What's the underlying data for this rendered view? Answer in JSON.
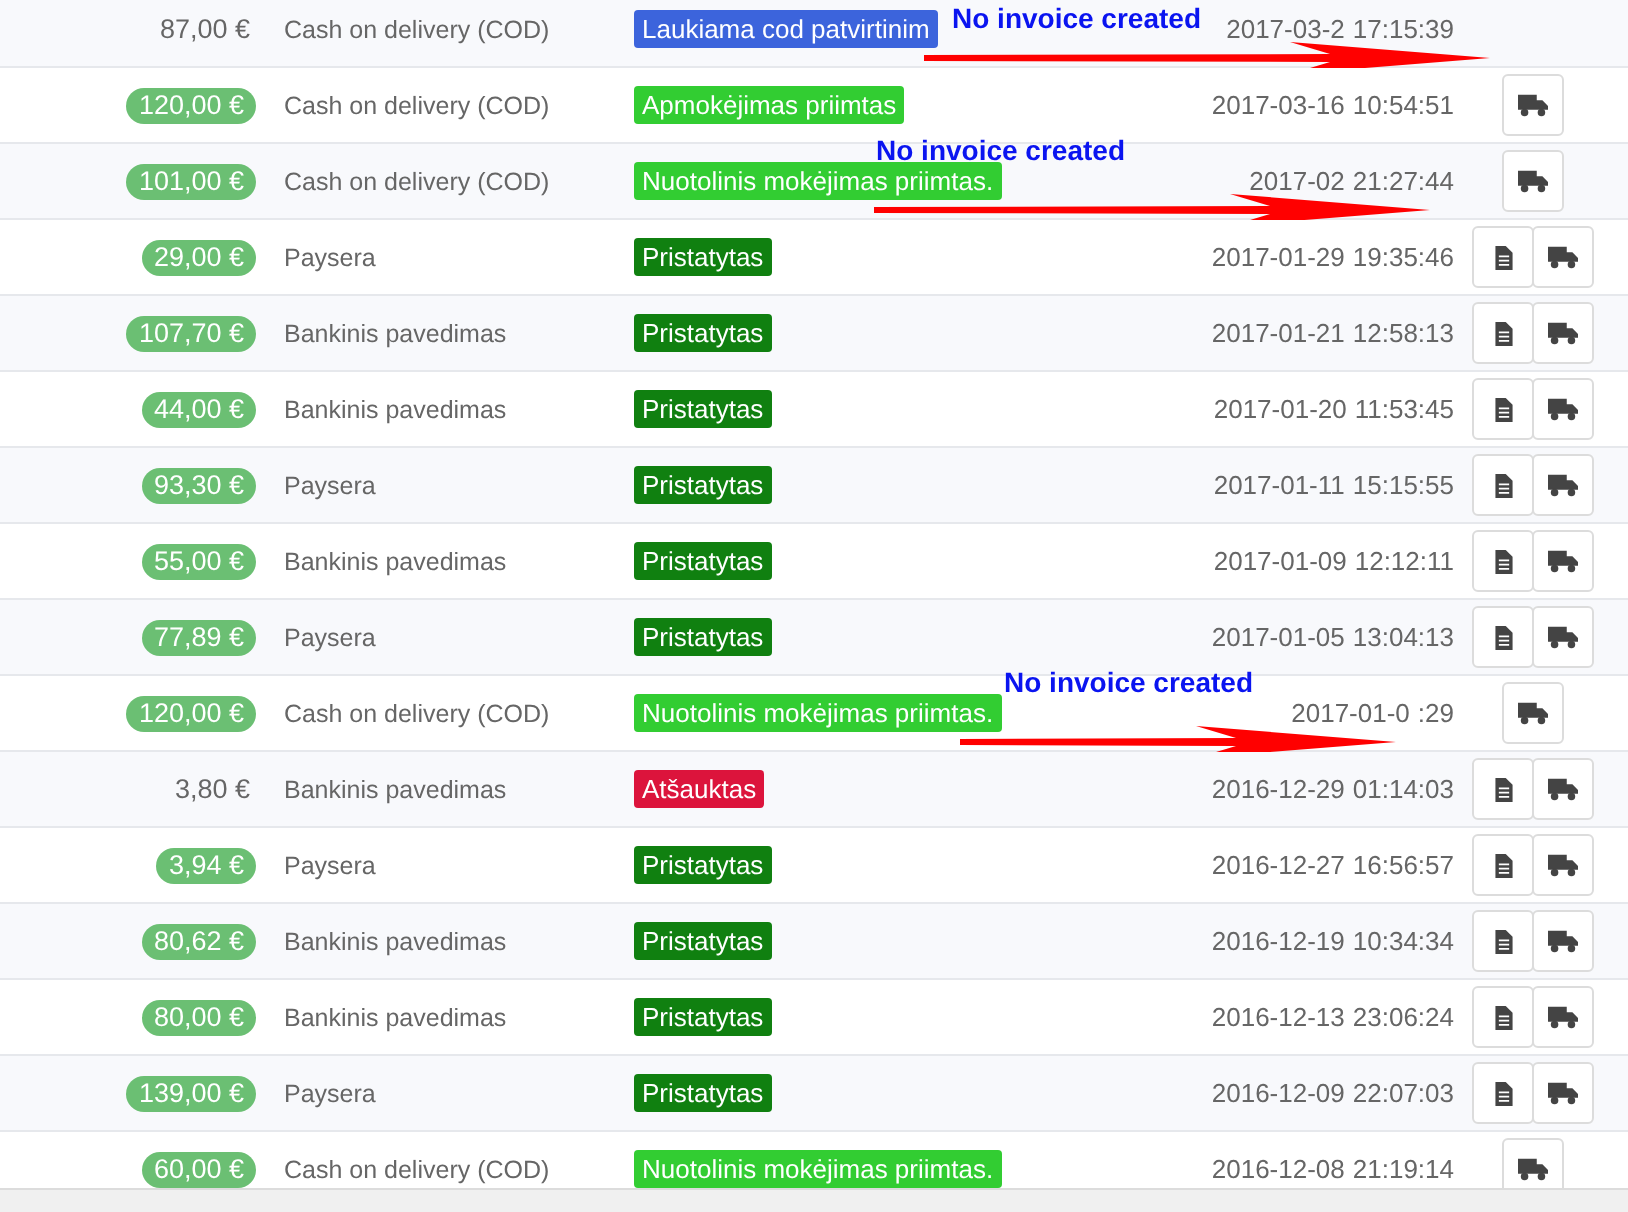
{
  "orders": [
    {
      "amount": "87,00 €",
      "paid": false,
      "payment": "Cash on delivery (COD)",
      "status": {
        "label": "Laukiama cod patvirtinim",
        "color": "#3c64dc"
      },
      "date": "2017-03-2",
      "time": "17:15:39",
      "annotation": "No invoice created"
    },
    {
      "amount": "120,00 €",
      "paid": true,
      "payment": "Cash on delivery (COD)",
      "status": {
        "label": "Apmokėjimas priimtas",
        "color": "#32cd32"
      },
      "date": "2017-03-16",
      "time": "10:54:51",
      "actions": [
        {
          "kind": "truck"
        }
      ]
    },
    {
      "amount": "101,00 €",
      "paid": true,
      "payment": "Cash on delivery (COD)",
      "status": {
        "label": "Nuotolinis mokėjimas priimtas.",
        "color": "#32cd32"
      },
      "date": "2017-02",
      "time": "21:27:44",
      "actions": [
        {
          "kind": "truck"
        }
      ],
      "annotation": "No invoice created"
    },
    {
      "amount": "29,00 €",
      "paid": true,
      "payment": "Paysera",
      "status": {
        "label": "Pristatytas",
        "color": "#108010"
      },
      "date": "2017-01-29",
      "time": "19:35:46",
      "actions": [
        {
          "kind": "invoice"
        },
        {
          "kind": "truck"
        }
      ]
    },
    {
      "amount": "107,70 €",
      "paid": true,
      "payment": "Bankinis pavedimas",
      "status": {
        "label": "Pristatytas",
        "color": "#108010"
      },
      "date": "2017-01-21",
      "time": "12:58:13",
      "actions": [
        {
          "kind": "invoice"
        },
        {
          "kind": "truck"
        }
      ]
    },
    {
      "amount": "44,00 €",
      "paid": true,
      "payment": "Bankinis pavedimas",
      "status": {
        "label": "Pristatytas",
        "color": "#108010"
      },
      "date": "2017-01-20",
      "time": "11:53:45",
      "actions": [
        {
          "kind": "invoice"
        },
        {
          "kind": "truck"
        }
      ]
    },
    {
      "amount": "93,30 €",
      "paid": true,
      "payment": "Paysera",
      "status": {
        "label": "Pristatytas",
        "color": "#108010"
      },
      "date": "2017-01-11",
      "time": "15:15:55",
      "actions": [
        {
          "kind": "invoice"
        },
        {
          "kind": "truck"
        }
      ]
    },
    {
      "amount": "55,00 €",
      "paid": true,
      "payment": "Bankinis pavedimas",
      "status": {
        "label": "Pristatytas",
        "color": "#108010"
      },
      "date": "2017-01-09",
      "time": "12:12:11",
      "actions": [
        {
          "kind": "invoice"
        },
        {
          "kind": "truck"
        }
      ]
    },
    {
      "amount": "77,89 €",
      "paid": true,
      "payment": "Paysera",
      "status": {
        "label": "Pristatytas",
        "color": "#108010"
      },
      "date": "2017-01-05",
      "time": "13:04:13",
      "actions": [
        {
          "kind": "invoice"
        },
        {
          "kind": "truck"
        }
      ]
    },
    {
      "amount": "120,00 €",
      "paid": true,
      "payment": "Cash on delivery (COD)",
      "status": {
        "label": "Nuotolinis mokėjimas priimtas.",
        "color": "#32cd32"
      },
      "date": "2017-01-0",
      "time": ":29",
      "actions": [
        {
          "kind": "truck"
        }
      ],
      "annotation": "No invoice created"
    },
    {
      "amount": "3,80 €",
      "paid": false,
      "payment": "Bankinis pavedimas",
      "status": {
        "label": "Atšauktas",
        "color": "#dc143c"
      },
      "date": "2016-12-29",
      "time": "01:14:03",
      "actions": [
        {
          "kind": "invoice"
        },
        {
          "kind": "truck"
        }
      ]
    },
    {
      "amount": "3,94 €",
      "paid": true,
      "payment": "Paysera",
      "status": {
        "label": "Pristatytas",
        "color": "#108010"
      },
      "date": "2016-12-27",
      "time": "16:56:57",
      "actions": [
        {
          "kind": "invoice"
        },
        {
          "kind": "truck"
        }
      ]
    },
    {
      "amount": "80,62 €",
      "paid": true,
      "payment": "Bankinis pavedimas",
      "status": {
        "label": "Pristatytas",
        "color": "#108010"
      },
      "date": "2016-12-19",
      "time": "10:34:34",
      "actions": [
        {
          "kind": "invoice"
        },
        {
          "kind": "truck"
        }
      ]
    },
    {
      "amount": "80,00 €",
      "paid": true,
      "payment": "Bankinis pavedimas",
      "status": {
        "label": "Pristatytas",
        "color": "#108010"
      },
      "date": "2016-12-13",
      "time": "23:06:24",
      "actions": [
        {
          "kind": "invoice"
        },
        {
          "kind": "truck"
        }
      ]
    },
    {
      "amount": "139,00 €",
      "paid": true,
      "payment": "Paysera",
      "status": {
        "label": "Pristatytas",
        "color": "#108010"
      },
      "date": "2016-12-09",
      "time": "22:07:03",
      "actions": [
        {
          "kind": "invoice"
        },
        {
          "kind": "truck"
        }
      ]
    },
    {
      "amount": "60,00 €",
      "paid": true,
      "payment": "Cash on delivery (COD)",
      "status": {
        "label": "Nuotolinis mokėjimas priimtas.",
        "color": "#32cd32"
      },
      "date": "2016-12-08",
      "time": "21:19:14",
      "actions": [
        {
          "kind": "truck"
        }
      ]
    }
  ]
}
